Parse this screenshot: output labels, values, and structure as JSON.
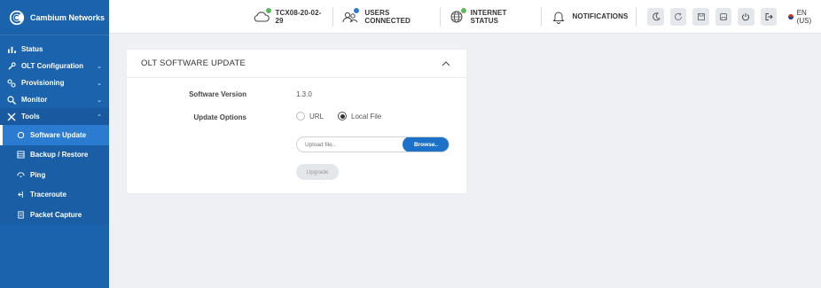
{
  "brand": {
    "name": "Cambium Networks"
  },
  "sidebar": {
    "items": [
      {
        "label": "Status",
        "icon": "bar-chart-icon"
      },
      {
        "label": "OLT Configuration",
        "icon": "wrench-icon",
        "chevron": "down"
      },
      {
        "label": "Provisioning",
        "icon": "gears-icon",
        "chevron": "down"
      },
      {
        "label": "Monitor",
        "icon": "magnifier-icon",
        "chevron": "down"
      },
      {
        "label": "Tools",
        "icon": "tools-icon",
        "chevron": "up"
      }
    ],
    "tools_sub": [
      {
        "label": "Software Update",
        "icon": "refresh-icon",
        "active": true
      },
      {
        "label": "Backup / Restore",
        "icon": "grid-icon"
      },
      {
        "label": "Ping",
        "icon": "ping-icon"
      },
      {
        "label": "Traceroute",
        "icon": "traceroute-icon"
      },
      {
        "label": "Packet Capture",
        "icon": "document-icon"
      }
    ]
  },
  "topbar": {
    "device": "TCX08-20-02-29",
    "users_connected": "USERS CONNECTED",
    "internet_status": "INTERNET STATUS",
    "notifications": "NOTIFICATIONS",
    "language": "EN (US)",
    "status_colors": {
      "ok": "#5cb85c",
      "info": "#2a7bd7"
    }
  },
  "card": {
    "title": "OLT SOFTWARE UPDATE",
    "software_version_label": "Software Version",
    "software_version_value": "1.3.0",
    "update_options_label": "Update Options",
    "option_url": "URL",
    "option_local": "Local File",
    "upload_placeholder": "Upload file..",
    "browse_label": "Browse..",
    "upgrade_label": "Upgrade"
  },
  "colors": {
    "sidebar": "#1b63ad",
    "active": "#2b7bd0",
    "accent": "#1d71c8"
  }
}
